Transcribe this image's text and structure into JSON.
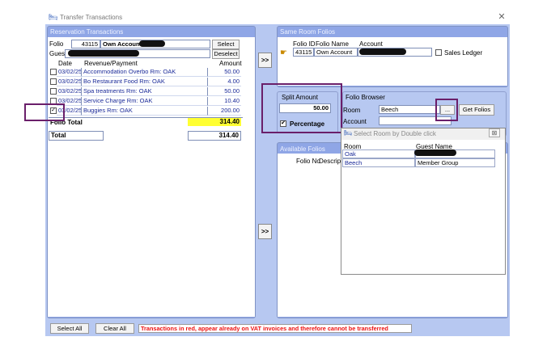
{
  "window": {
    "title": "Transfer Transactions",
    "close_icon": "close-icon"
  },
  "reservation": {
    "header": "Reservation Transactions",
    "folio_label": "Folio",
    "folio_id": "43115",
    "folio_name": "Own Account",
    "guest_label": "Guest",
    "select_label": "Select",
    "deselect_label": "Deselect",
    "columns": {
      "date": "Date",
      "revenue": "Revenue/Payment",
      "amount": "Amount"
    },
    "rows": [
      {
        "date": "03/02/25",
        "desc": "Accommodation Overbo Rm: OAK",
        "amount": "50.00",
        "checked": false
      },
      {
        "date": "03/02/25",
        "desc": "Bo Restaurant Food Rm: OAK",
        "amount": "4.00",
        "checked": false
      },
      {
        "date": "03/02/25",
        "desc": "Spa treatments Rm: OAK",
        "amount": "50.00",
        "checked": false
      },
      {
        "date": "03/02/25",
        "desc": "Service Charge Rm: OAK",
        "amount": "10.40",
        "checked": false
      },
      {
        "date": "03/02/25",
        "desc": "Buggies Rm: OAK",
        "amount": "200.00",
        "checked": true
      }
    ],
    "folio_total_label": "Folio Total",
    "folio_total": "314.40",
    "total_label": "Total",
    "total": "314.40"
  },
  "transfer_btn_top": ">>",
  "transfer_btn_bottom": ">>",
  "same_room": {
    "header": "Same Room Folios",
    "col_folio_id": "Folio ID",
    "col_folio_name": "Folio Name",
    "col_account": "Account",
    "row_folio_id": "43115",
    "row_folio_name": "Own Account",
    "sales_ledger_label": "Sales Ledger"
  },
  "split": {
    "header": "Split Amount",
    "value": "50.00",
    "percentage_label": "Percentage",
    "percentage_checked": "✔"
  },
  "folio_browser": {
    "header": "Folio Browser",
    "room_label": "Room",
    "room_value": "Beech",
    "ellipsis": "...",
    "get_folios_label": "Get Folios",
    "account_label": "Account"
  },
  "available": {
    "header": "Available Folios",
    "col_folio_no": "Folio No",
    "col_desc": "Descripti"
  },
  "room_popup": {
    "title": "Select Room by Double click",
    "close_glyph": "⊠",
    "col_room": "Room",
    "col_guest": "Guest Name",
    "rows": [
      {
        "room": "Oak",
        "guest": ""
      },
      {
        "room": "Beech",
        "guest": "Member Group"
      }
    ]
  },
  "footer": {
    "select_all": "Select All",
    "clear_all": "Clear All",
    "notice": "Transactions in red, appear already on VAT invoices and therefore cannot be transferred"
  }
}
